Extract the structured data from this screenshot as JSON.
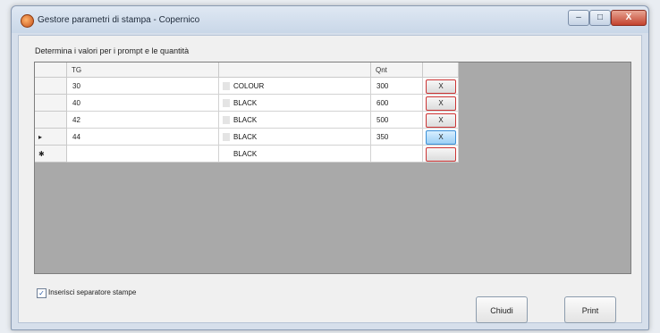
{
  "window": {
    "title": "Gestore parametri di stampa - Copernico",
    "controls": {
      "minimize": "–",
      "maximize": "□",
      "close": "X"
    }
  },
  "form": {
    "prompt_label": "Determina i valori per i prompt e le quantità",
    "columns": {
      "tg": "TG",
      "combo": "",
      "qnt": "Qnt",
      "action": ""
    },
    "rows": [
      {
        "marker": "",
        "tg": "30",
        "combo": "COLOUR",
        "qnt": "300",
        "delete": "X"
      },
      {
        "marker": "",
        "tg": "40",
        "combo": "BLACK",
        "qnt": "600",
        "delete": "X"
      },
      {
        "marker": "",
        "tg": "42",
        "combo": "BLACK",
        "qnt": "500",
        "delete": "X"
      },
      {
        "marker": "▸",
        "tg": "44",
        "combo": "BLACK",
        "qnt": "350",
        "delete": "X"
      },
      {
        "marker": "✱",
        "tg": "",
        "combo": "BLACK",
        "qnt": "",
        "delete": ""
      }
    ],
    "separator_checkbox": {
      "checked": "✓",
      "label": "Inserisci separatore stampe"
    },
    "buttons": {
      "close": "Chiudi",
      "print": "Print"
    }
  }
}
